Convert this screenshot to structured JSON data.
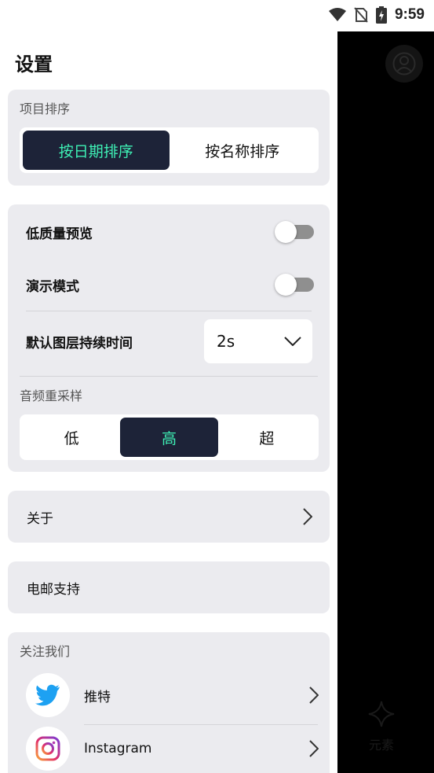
{
  "status_bar": {
    "time": "9:59",
    "icons": [
      "wifi-icon",
      "no-sim-icon",
      "battery-charging-icon"
    ]
  },
  "drawer": {
    "title": "设置",
    "sort": {
      "label": "项目排序",
      "options": [
        "按日期排序",
        "按名称排序"
      ],
      "selected": "按日期排序"
    },
    "settings": {
      "low_quality_preview": {
        "label": "低质量预览",
        "on": false
      },
      "demo_mode": {
        "label": "演示模式",
        "on": false
      },
      "default_layer_duration": {
        "label": "默认图层持续时间",
        "value": "2s"
      },
      "audio_resample": {
        "label": "音频重采样",
        "options": [
          "低",
          "高",
          "超"
        ],
        "selected": "高"
      }
    },
    "about": {
      "label": "关于"
    },
    "email_support": {
      "label": "电邮支持"
    },
    "follow": {
      "label": "关注我们",
      "items": [
        {
          "label": "推特",
          "icon": "twitter-icon"
        },
        {
          "label": "Instagram",
          "icon": "instagram-icon"
        }
      ]
    }
  },
  "right_pane": {
    "tab_label": "元素",
    "tab_icon": "sparkle-icon",
    "avatar_icon": "user-icon"
  },
  "colors": {
    "accent": "#3ef0b5",
    "active_bg": "#1d2338",
    "card_bg": "#ebebef",
    "twitter": "#1da1f2"
  }
}
